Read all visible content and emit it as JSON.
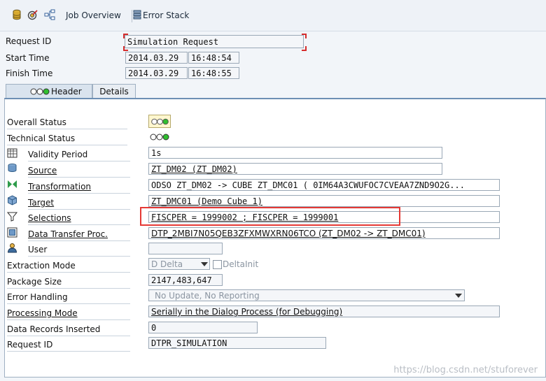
{
  "toolbar": {
    "job_overview_label": "Job Overview",
    "error_stack_label": "Error Stack",
    "icons": [
      "database-icon",
      "target-check-icon",
      "hierarchy-icon",
      "stack-icon"
    ]
  },
  "header": {
    "request_id_label": "Request ID",
    "request_id_value": "Simulation Request",
    "start_time_label": "Start Time",
    "start_date": "2014.03.29",
    "start_time": "16:48:54",
    "finish_time_label": "Finish Time",
    "finish_date": "2014.03.29",
    "finish_time": "16:48:55"
  },
  "tabs": [
    {
      "label": "Header",
      "active": true
    },
    {
      "label": "Details",
      "active": false
    }
  ],
  "rows": {
    "overall_status": {
      "label": "Overall Status"
    },
    "technical_status": {
      "label": "Technical Status"
    },
    "validity_period": {
      "label": "Validity Period",
      "value": "1s"
    },
    "source": {
      "label": "Source",
      "value": "ZT_DM02 (ZT_DM02)"
    },
    "transformation": {
      "label": "Transformation",
      "value": "ODSO ZT_DM02 -> CUBE ZT_DMC01 ( 0IM64A3CWUFOC7CVEAA7ZND9O2G..."
    },
    "target": {
      "label": "Target",
      "value": "ZT_DMC01 (Demo Cube 1)"
    },
    "selections": {
      "label": "Selections",
      "value": "FISCPER = 1999002 ; FISCPER = 1999001"
    },
    "dtp": {
      "label": "Data Transfer Proc.",
      "value": "DTP_2MBI7N05QEB3ZFXMWXRN06TCO (ZT_DM02 -> ZT_DMC01)"
    },
    "user": {
      "label": "User",
      "value": ""
    },
    "extraction_mode": {
      "label": "Extraction Mode",
      "value": "D Delta",
      "checkbox_label": "DeltaInit"
    },
    "package_size": {
      "label": "Package Size",
      "value": "2147,483,647"
    },
    "error_handling": {
      "label": "Error Handling",
      "value": "No Update, No Reporting"
    },
    "processing_mode": {
      "label": "Processing Mode",
      "value": "Serially in the Dialog Process (for Debugging)"
    },
    "data_records": {
      "label": "Data Records Inserted",
      "value": "0"
    },
    "request_id": {
      "label": "Request ID",
      "value": "DTPR_SIMULATION"
    }
  },
  "watermark": "https://blog.csdn.net/stuforever",
  "colors": {
    "accent": "#6d8fb4",
    "highlight": "#e53935",
    "light_green": "#2fbf2f"
  }
}
